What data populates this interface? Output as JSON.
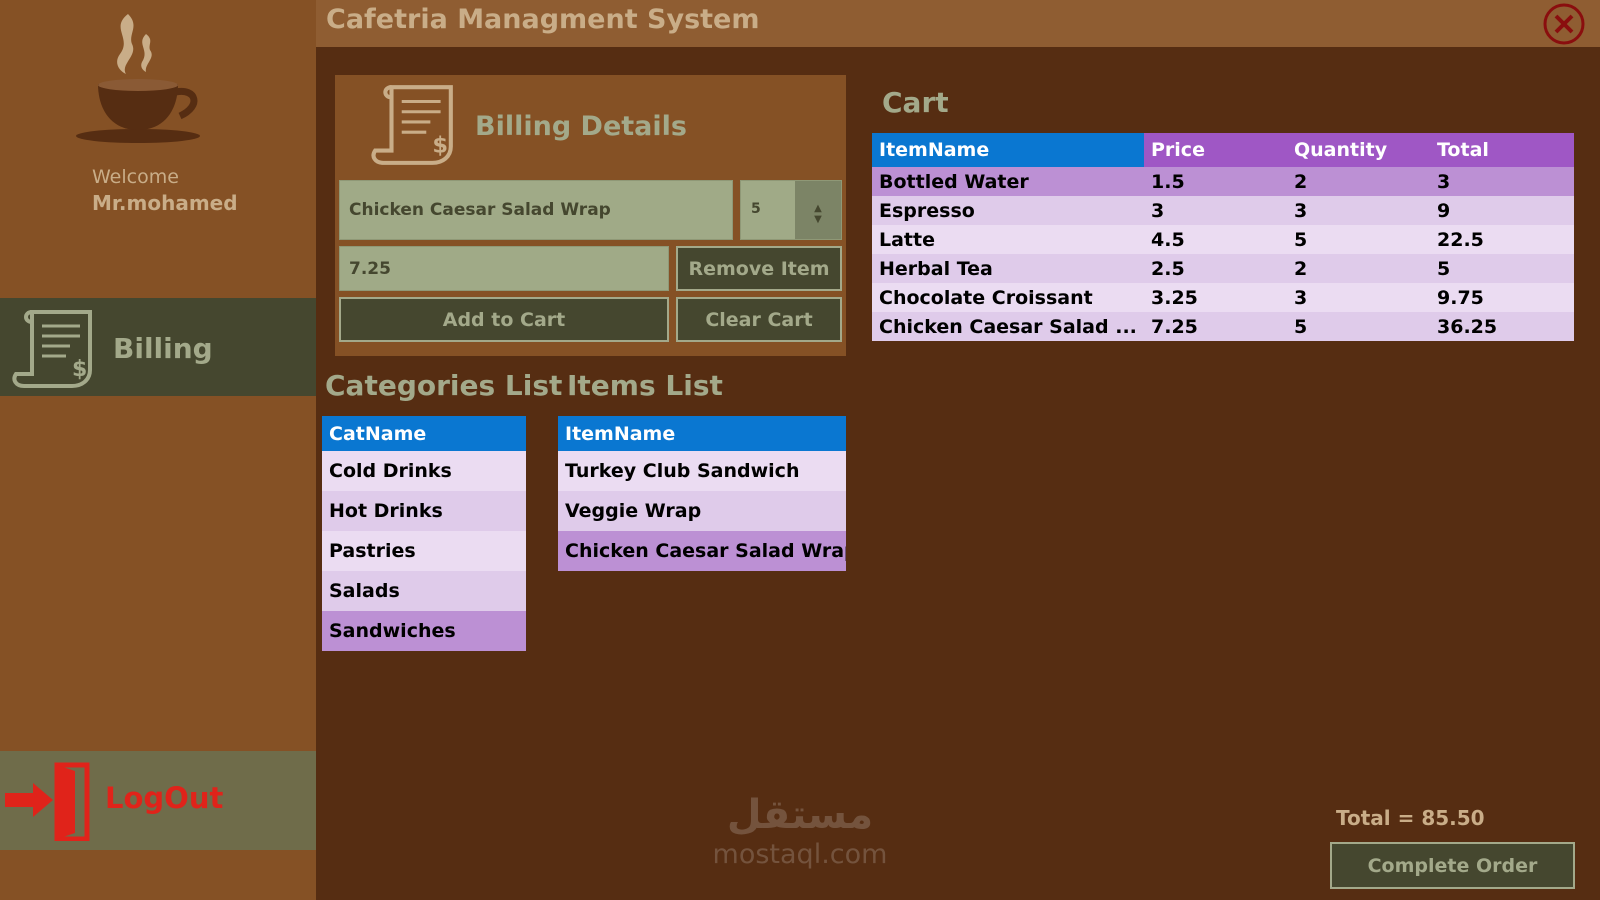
{
  "app": {
    "title": "Cafetria Managment System"
  },
  "sidebar": {
    "welcome": "Welcome",
    "user": "Mr.mohamed",
    "nav_billing": "Billing",
    "logout": "LogOut"
  },
  "billing": {
    "title": "Billing Details",
    "item_name": "Chicken Caesar Salad Wrap",
    "quantity": "5",
    "price": "7.25",
    "remove_label": "Remove Item",
    "add_label": "Add to Cart",
    "clear_label": "Clear Cart"
  },
  "categories": {
    "heading": "Categories List",
    "header": "CatName",
    "rows": [
      "Cold Drinks",
      "Hot Drinks",
      "Pastries",
      "Salads",
      "Sandwiches"
    ],
    "selected_index": 4
  },
  "items": {
    "heading": "Items List",
    "header": "ItemName",
    "rows": [
      "Turkey Club Sandwich",
      "Veggie Wrap",
      "Chicken Caesar Salad Wrap"
    ],
    "selected_index": 2
  },
  "cart": {
    "heading": "Cart",
    "headers": [
      "ItemName",
      "Price",
      "Quantity",
      "Total"
    ],
    "rows": [
      [
        "Bottled Water",
        "1.5",
        "2",
        "3"
      ],
      [
        "Espresso",
        "3",
        "3",
        "9"
      ],
      [
        "Latte",
        "4.5",
        "5",
        "22.5"
      ],
      [
        "Herbal Tea",
        "2.5",
        "2",
        "5"
      ],
      [
        "Chocolate Croissant",
        "3.25",
        "3",
        "9.75"
      ],
      [
        "Chicken Caesar Salad ...",
        "7.25",
        "5",
        "36.25"
      ]
    ],
    "selected_index": 0,
    "total_label": "Total = 85.50",
    "complete_label": "Complete Order"
  },
  "watermark": {
    "arabic": "مستقل",
    "latin": "mostaql.com"
  },
  "icons": {
    "logo": "coffee-cup-icon",
    "billing": "receipt-icon",
    "logout": "exit-door-icon",
    "close": "close-circle-icon",
    "spinner": "up-down-icon"
  },
  "colors": {
    "background": "#562d12",
    "sidebar": "#855125",
    "accent_dark": "#45472f",
    "accent_text": "#a3a98a",
    "table_header": "#0a77d1",
    "cart_header": "#9f57c5",
    "selected_row": "#bc90d4",
    "logout_red": "#e0231a"
  }
}
